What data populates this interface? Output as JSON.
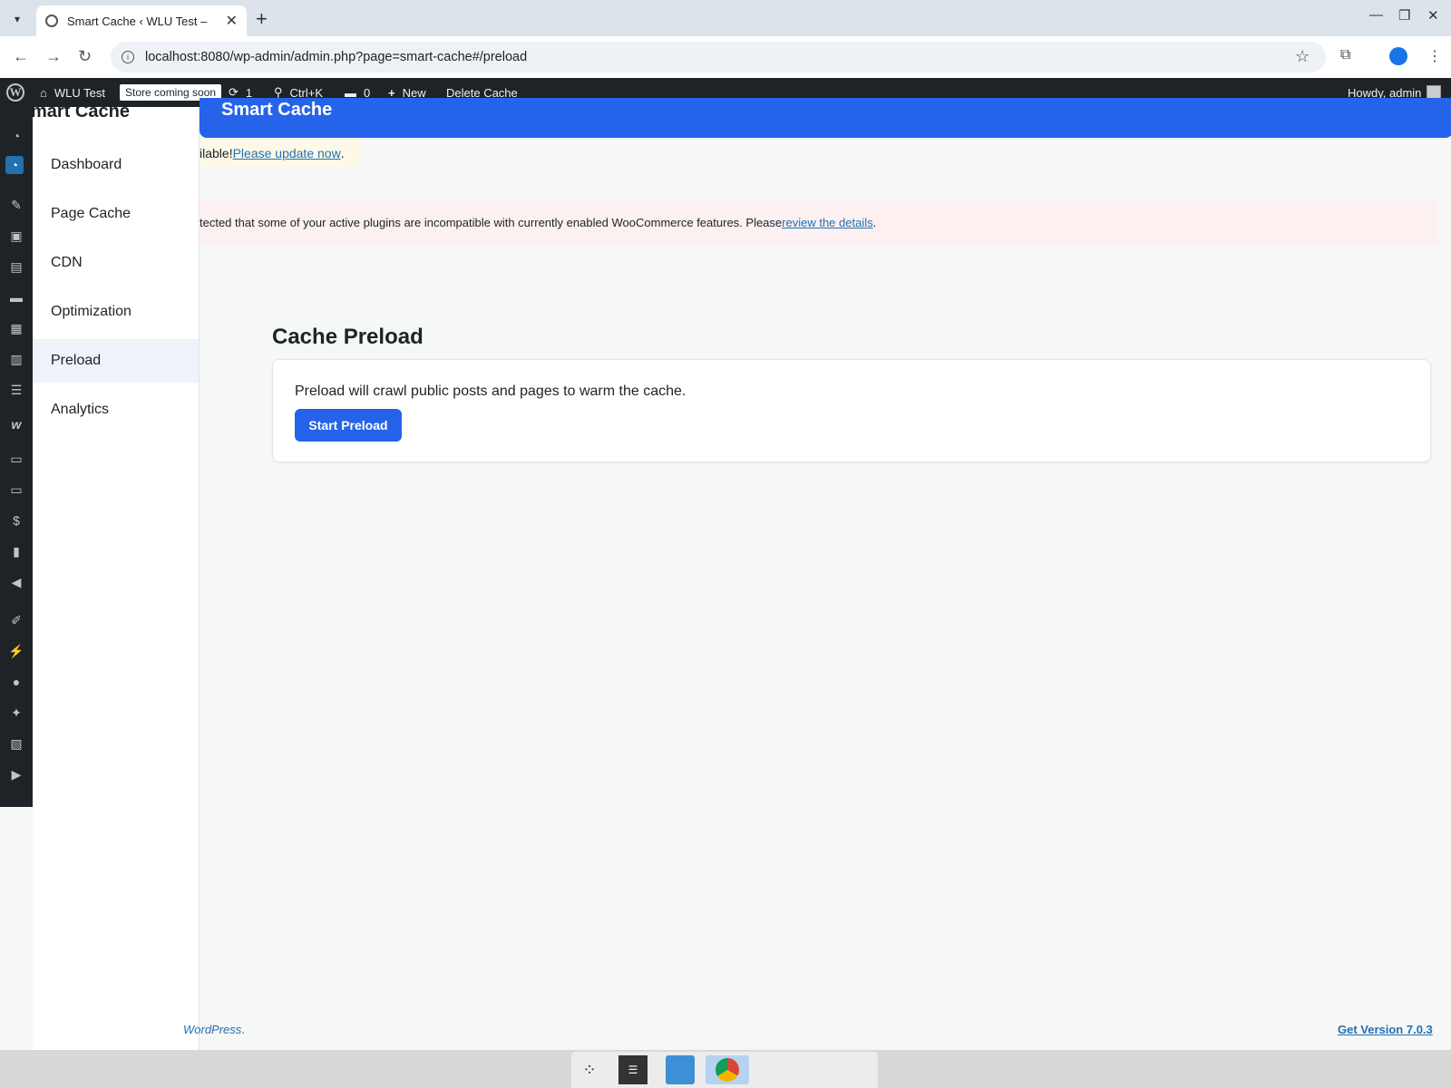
{
  "browser": {
    "tab_title": "Smart Cache ‹ WLU Test –",
    "url": "localhost:8080/wp-admin/admin.php?page=smart-cache#/preload"
  },
  "adminbar": {
    "site_name": "WLU Test",
    "store_badge": "Store coming soon",
    "updates_count": "1",
    "search_shortcut": "Ctrl+K",
    "comments_count": "0",
    "new_label": "New",
    "delete_cache_label": "Delete Cache",
    "greeting": "Howdy, admin"
  },
  "wp_menu_icons": [
    "dashboard-icon",
    "smart-cache-icon",
    "posts-icon",
    "media-icon",
    "pages-icon",
    "comments-icon",
    "calendar-icon",
    "forms-icon",
    "list-icon",
    "woocommerce-icon",
    "products-icon",
    "payments-icon",
    "finance-icon",
    "analytics-icon",
    "marketing-icon",
    "appearance-icon",
    "plugins-icon",
    "users-icon",
    "tools-icon",
    "settings-icon",
    "play-icon"
  ],
  "plugin": {
    "brand": "mart Cache",
    "banner_title": "Smart Cache",
    "nav": [
      {
        "label": "Dashboard"
      },
      {
        "label": "Page Cache"
      },
      {
        "label": "CDN"
      },
      {
        "label": "Optimization"
      },
      {
        "label": "Preload"
      },
      {
        "label": "Analytics"
      }
    ],
    "active_nav": "Preload"
  },
  "notices": {
    "update_prefix": "ilable! ",
    "update_link": "Please update now",
    "update_suffix": ".",
    "error_prefix": "tected that some of your active plugins are incompatible with currently enabled WooCommerce features. Please ",
    "error_link": "review the details",
    "error_suffix": "."
  },
  "main": {
    "section_title": "Cache Preload",
    "description": "Preload will crawl public posts and pages to warm the cache.",
    "button_label": "Start Preload"
  },
  "footer": {
    "left_link": "WordPress",
    "left_suffix": ".",
    "right_link": "Get Version 7.0.3"
  },
  "colors": {
    "accent": "#2563eb",
    "wp_dark": "#1d2327",
    "link": "#2271b1"
  }
}
